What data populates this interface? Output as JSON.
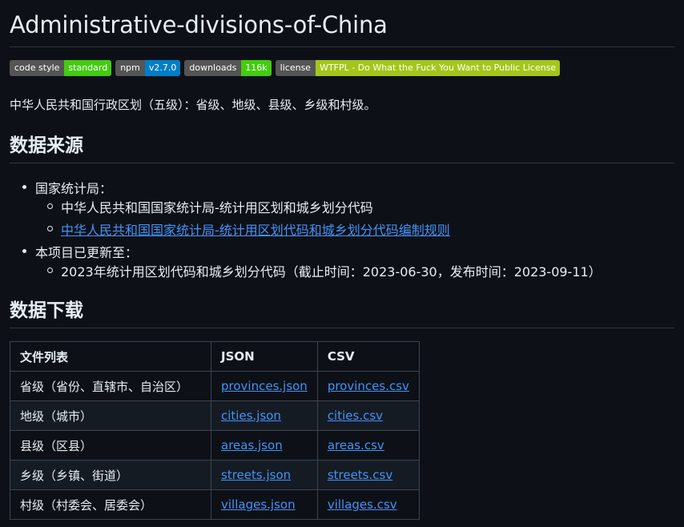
{
  "title": "Administrative-divisions-of-China",
  "badges": [
    {
      "label": "code style",
      "value": "standard",
      "color": "#44cc11"
    },
    {
      "label": "npm",
      "value": "v2.7.0",
      "color": "#007ec6"
    },
    {
      "label": "downloads",
      "value": "116k",
      "color": "#44cc11"
    },
    {
      "label": "license",
      "value": "WTFPL - Do What the Fuck You Want to Public License",
      "color": "#a4c61a"
    }
  ],
  "description": "中华人民共和国行政区划（五级）：省级、地级、县级、乡级和村级。",
  "sources": {
    "heading": "数据来源",
    "item1": "国家统计局：",
    "item1_sub1": "中华人民共和国国家统计局-统计用区划和城乡划分代码",
    "item1_sub2": "中华人民共和国国家统计局-统计用区划代码和城乡划分代码编制规则",
    "item2": "本项目已更新至：",
    "item2_sub1": "2023年统计用区划代码和城乡划分代码（截止时间：2023-06-30，发布时间：2023-09-11）"
  },
  "download": {
    "heading": "数据下载",
    "headers": [
      "文件列表",
      "JSON",
      "CSV"
    ],
    "rows": [
      {
        "name": "省级（省份、直辖市、自治区）",
        "json": "provinces.json",
        "csv": "provinces.csv"
      },
      {
        "name": "地级（城市）",
        "json": "cities.json",
        "csv": "cities.csv"
      },
      {
        "name": "县级（区县）",
        "json": "areas.json",
        "csv": "areas.csv"
      },
      {
        "name": "乡级（乡镇、街道）",
        "json": "streets.json",
        "csv": "streets.csv"
      },
      {
        "name": "村级（村委会、居委会）",
        "json": "villages.json",
        "csv": "villages.csv"
      }
    ]
  },
  "colors": {
    "background": "#0d1117",
    "text": "#e6edf3",
    "link": "#4493f8",
    "border": "#30363d"
  }
}
